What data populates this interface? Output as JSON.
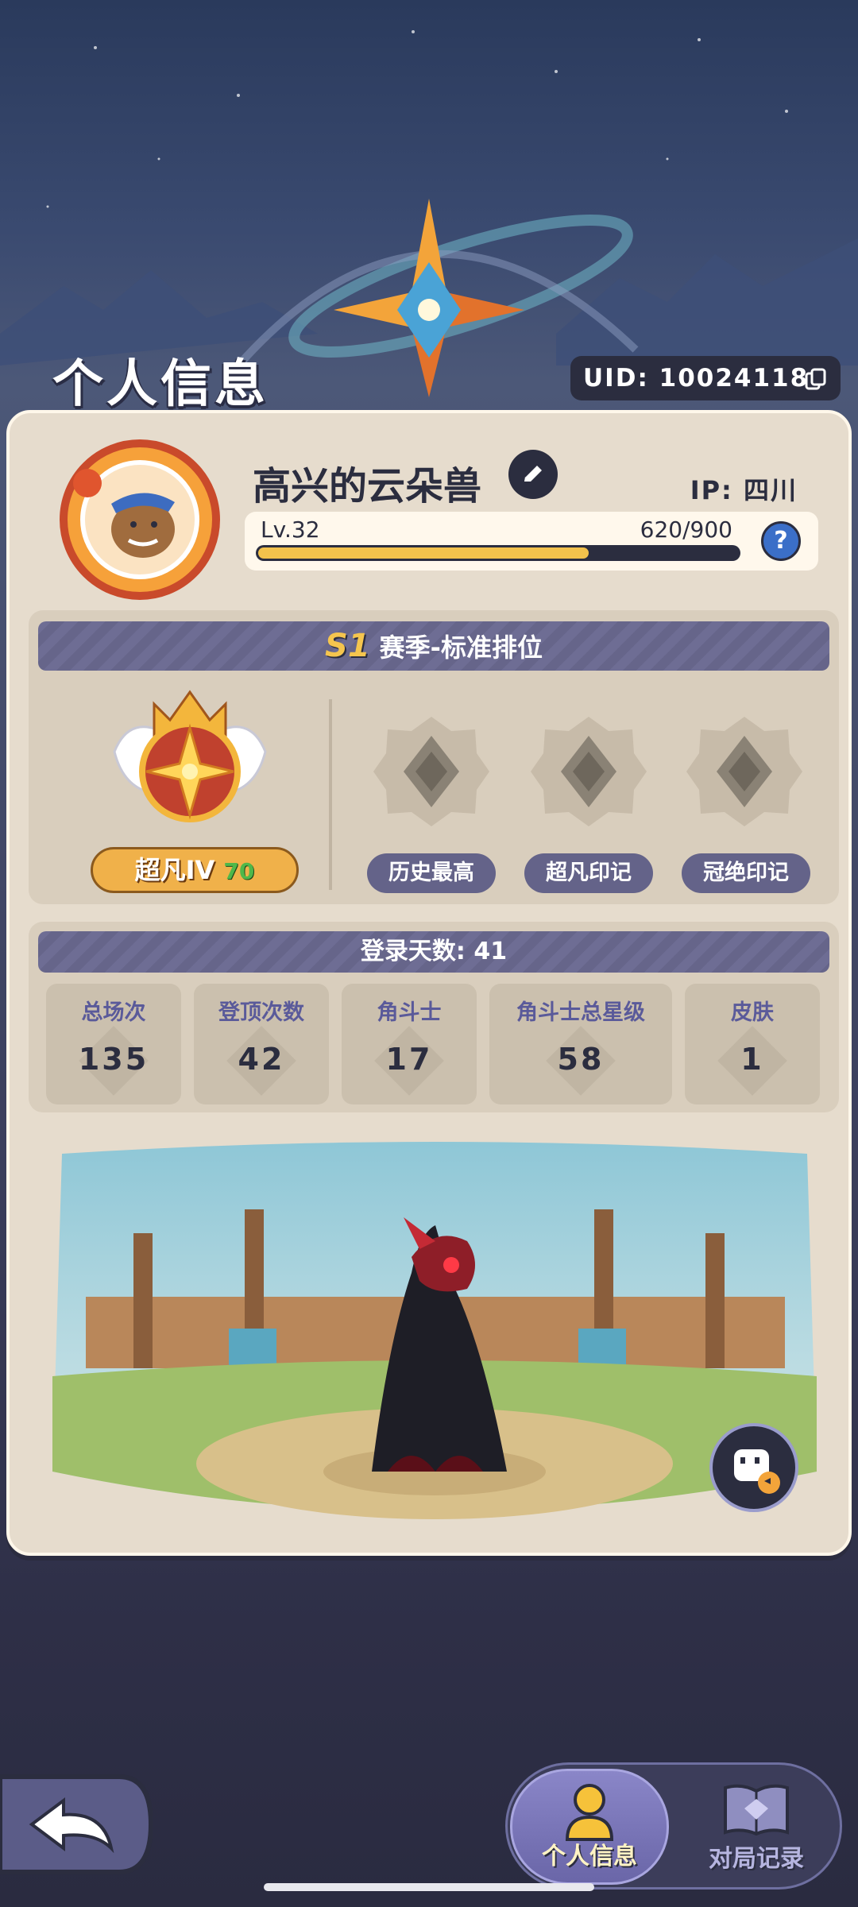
{
  "header": {
    "title": "个人信息",
    "uid_text": "UID: 10024118"
  },
  "profile": {
    "nickname": "高兴的云朵兽",
    "ip_text": "IP: 四川",
    "level_text": "Lv.32",
    "xp_text": "620/900",
    "xp_progress": 0.689,
    "help_label": "?"
  },
  "season": {
    "tag": "S1",
    "title": "赛季-标准排位",
    "rank_name": "超凡IV",
    "rank_points": "70",
    "badges": [
      {
        "label": "历史最高"
      },
      {
        "label": "超凡印记"
      },
      {
        "label": "冠绝印记"
      }
    ]
  },
  "stats": {
    "login_days_text": "登录天数: 41",
    "items": [
      {
        "label": "总场次",
        "value": "135"
      },
      {
        "label": "登顶次数",
        "value": "42"
      },
      {
        "label": "角斗士",
        "value": "17"
      },
      {
        "label": "角斗士总星级",
        "value": "58"
      },
      {
        "label": "皮肤",
        "value": "1"
      }
    ]
  },
  "nav": {
    "tabs": [
      {
        "label": "个人信息",
        "active": true
      },
      {
        "label": "对局记录",
        "active": false
      }
    ]
  },
  "colors": {
    "accent_gold": "#f3c24c",
    "banner_purple": "#6e6d94",
    "card_bg": "#e6dccd"
  }
}
